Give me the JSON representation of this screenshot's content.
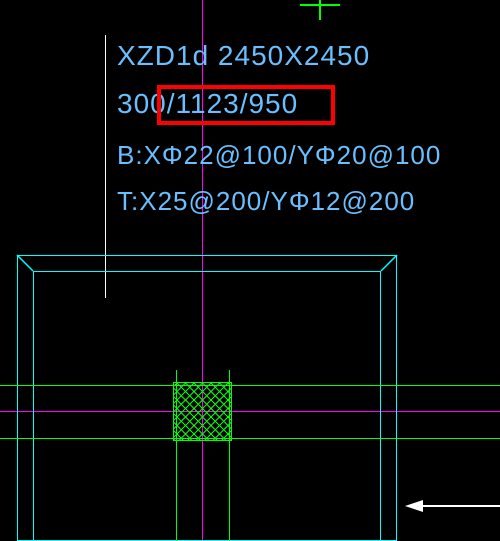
{
  "annotations": {
    "row1": "XZD1d 2450X2450",
    "row2a": "300",
    "row2b": "/1123/950",
    "row3": "B:XΦ22@100/YΦ20@100",
    "row4": "T:X25@200/YΦ12@200"
  },
  "highlight": {
    "covers_text": "/1123/950",
    "color": "#ff0000"
  },
  "crosshair": {
    "color": "#ff00ff"
  },
  "geometry": {
    "footing_outline_color": "#00ffff",
    "column_hatch_color": "#00ff00"
  }
}
